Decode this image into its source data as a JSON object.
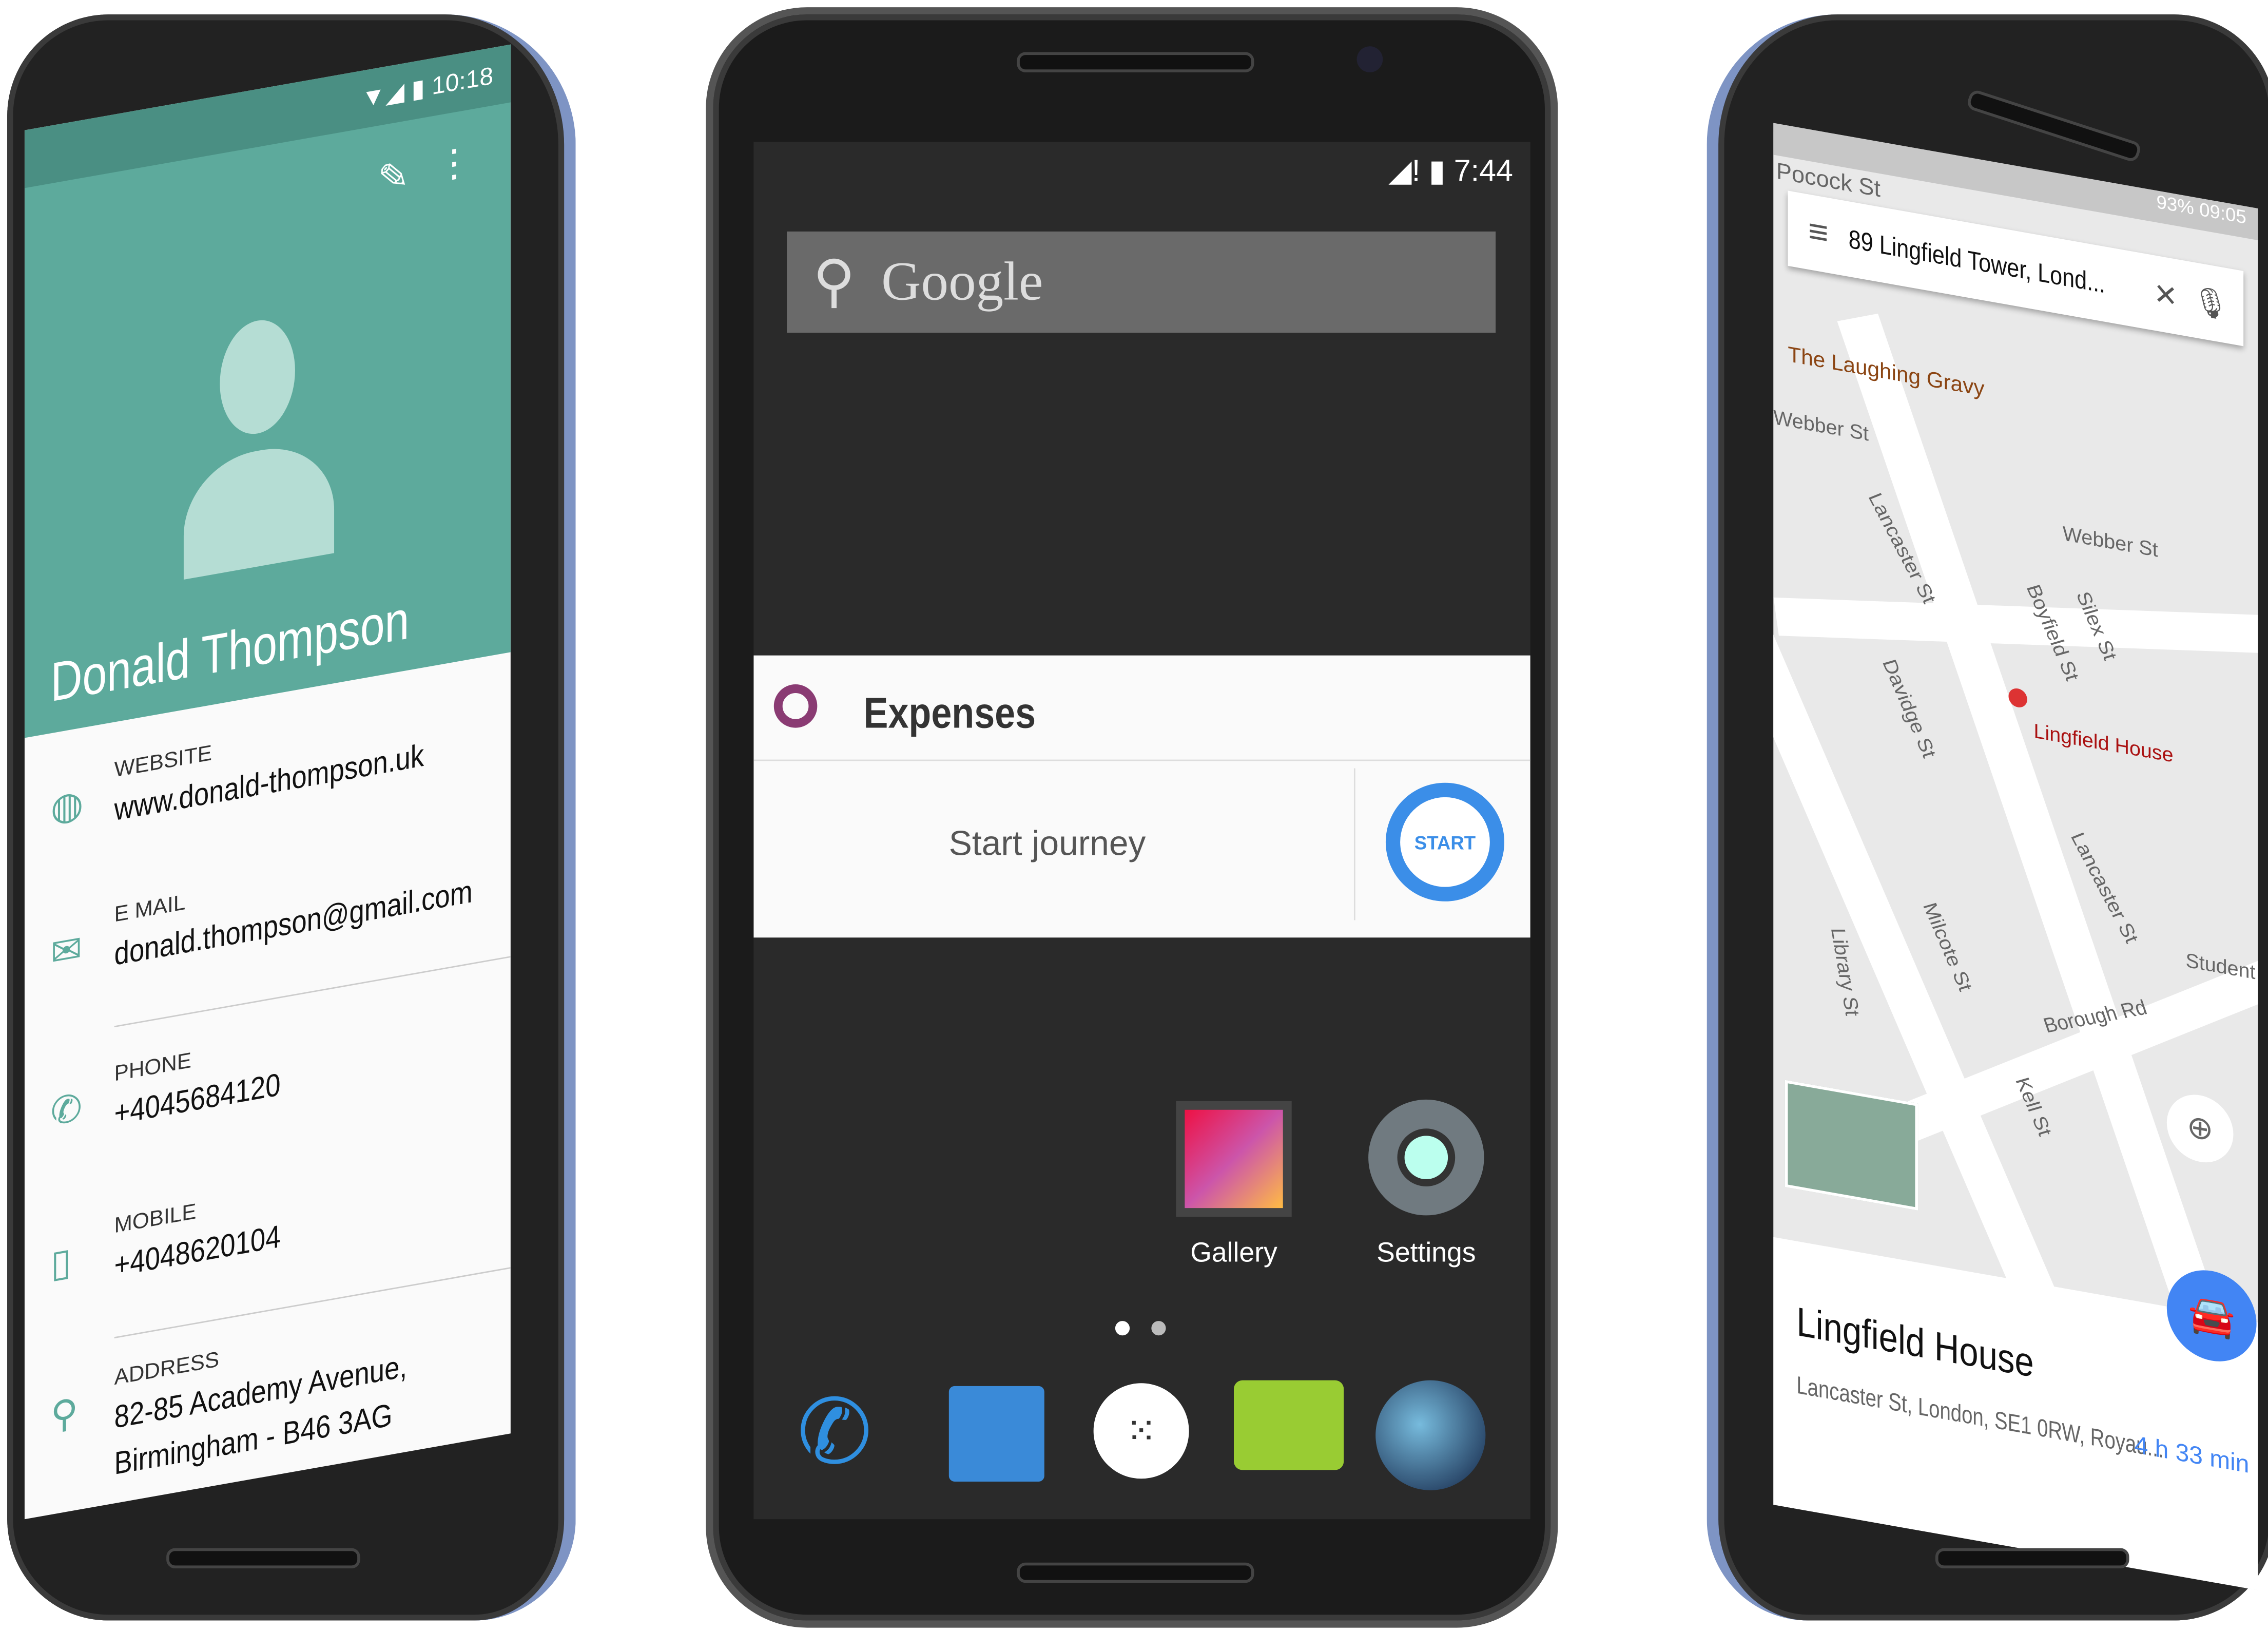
{
  "contact_phone": {
    "status_time": "10:18",
    "name": "Donald Thompson",
    "accent": "#5daa9c",
    "fields": [
      {
        "label": "WEBSITE",
        "value": "www.donald-thompson.uk",
        "icon": "globe-icon"
      },
      {
        "label": "E MAIL",
        "value": "donald.thompson@gmail.com",
        "icon": "email-icon"
      },
      {
        "label": "PHONE",
        "value": "+4045684120",
        "icon": "phone-icon"
      },
      {
        "label": "MOBILE",
        "value": "+4048620104",
        "icon": "mobile-icon"
      },
      {
        "label": "ADDRESS",
        "value": "82-85 Academy Avenue,",
        "value2": "Birmingham - B46 3AG",
        "icon": "location-pin-icon"
      }
    ]
  },
  "home_phone": {
    "status_time": "7:44",
    "search_label": "Google",
    "widget": {
      "title": "Expenses",
      "action_text": "Start journey",
      "button": "START",
      "accent": "#3b8ee8"
    },
    "apps": [
      {
        "label": "Gallery"
      },
      {
        "label": "Settings"
      }
    ],
    "dock": [
      "phone-icon",
      "contacts-icon",
      "app-drawer-icon",
      "messaging-icon",
      "browser-icon"
    ]
  },
  "maps_phone": {
    "status_battery": "93%",
    "status_time": "09:05",
    "search_value": "89 Lingfield Tower, Lond...",
    "map_labels": [
      "Pocock St",
      "The Laughing Gravy",
      "Webber St",
      "Webber St",
      "Lancaster St",
      "Boyfield St",
      "Silex St",
      "Davidge St",
      "Lingfield House",
      "Library St",
      "Milcote St",
      "Lancaster St",
      "Borough Rd",
      "Kell St",
      "Student Centre"
    ],
    "place": {
      "name": "Lingfield House",
      "address": "Lancaster St, London, SE1 0RW, Royau...",
      "eta": "4 h 33 min"
    },
    "accent": "#4285f4"
  }
}
